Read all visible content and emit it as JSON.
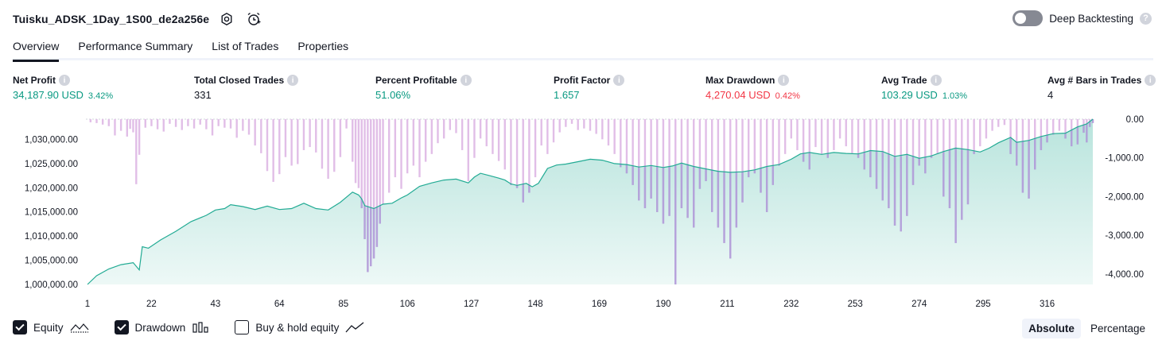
{
  "header": {
    "strategy_title": "Tuisku_ADSK_1Day_1S00_de2a256e",
    "settings_icon": "gear-icon",
    "alert_icon": "alarm-clock-plus-icon",
    "deep_backtesting_label": "Deep Backtesting",
    "deep_backtesting_enabled": false,
    "help_glyph": "?"
  },
  "tabs": [
    {
      "label": "Overview",
      "active": true
    },
    {
      "label": "Performance Summary",
      "active": false
    },
    {
      "label": "List of Trades",
      "active": false
    },
    {
      "label": "Properties",
      "active": false
    }
  ],
  "metrics": [
    {
      "label": "Net Profit",
      "value": "34,187.90 USD",
      "sub": "3.42%",
      "color": "#089981"
    },
    {
      "label": "Total Closed Trades",
      "value": "331",
      "sub": "",
      "color": "#131722"
    },
    {
      "label": "Percent Profitable",
      "value": "51.06%",
      "sub": "",
      "color": "#089981"
    },
    {
      "label": "Profit Factor",
      "value": "1.657",
      "sub": "",
      "color": "#089981"
    },
    {
      "label": "Max Drawdown",
      "value": "4,270.04 USD",
      "sub": "0.42%",
      "color": "#f23645"
    },
    {
      "label": "Avg Trade",
      "value": "103.29 USD",
      "sub": "1.03%",
      "color": "#089981"
    },
    {
      "label": "Avg # Bars in Trades",
      "value": "4",
      "sub": "",
      "color": "#131722"
    }
  ],
  "legend": {
    "equity_label": "Equity",
    "equity_checked": true,
    "drawdown_label": "Drawdown",
    "drawdown_checked": true,
    "buyhold_label": "Buy & hold equity",
    "buyhold_checked": false
  },
  "mode": {
    "absolute_label": "Absolute",
    "percentage_label": "Percentage",
    "active": "Absolute"
  },
  "colors": {
    "equity_line": "#22ab94",
    "drawdown_bar": "#e1bee7",
    "drawdown_bar_overlap": "#b39ddb",
    "negative": "#f23645",
    "positive": "#089981"
  },
  "chart_data": {
    "type": "area",
    "x_ticks": [
      1,
      22,
      43,
      64,
      85,
      106,
      127,
      148,
      169,
      190,
      211,
      232,
      253,
      274,
      295,
      316
    ],
    "x_range": [
      1,
      331
    ],
    "left_axis": {
      "ticks": [
        1000000,
        1005000,
        1010000,
        1015000,
        1020000,
        1025000,
        1030000
      ],
      "tick_labels": [
        "1,000,000.00",
        "1,005,000.00",
        "1,010,000.00",
        "1,015,000.00",
        "1,020,000.00",
        "1,025,000.00",
        "1,030,000.00"
      ],
      "range": [
        1000000,
        1034187.9
      ]
    },
    "right_axis": {
      "ticks": [
        0,
        -1000,
        -2000,
        -3000,
        -4000
      ],
      "tick_labels": [
        "0.00",
        "-1,000.00",
        "-2,000.00",
        "-3,000.00",
        "-4,000.00"
      ],
      "range": [
        -4270.04,
        0
      ]
    },
    "series": [
      {
        "name": "Equity",
        "type": "area",
        "points": [
          [
            1,
            1000000
          ],
          [
            4,
            1001800
          ],
          [
            8,
            1003200
          ],
          [
            12,
            1004100
          ],
          [
            16,
            1004500
          ],
          [
            18,
            1003000
          ],
          [
            19,
            1007800
          ],
          [
            21,
            1007500
          ],
          [
            25,
            1009200
          ],
          [
            30,
            1011000
          ],
          [
            35,
            1013000
          ],
          [
            40,
            1014300
          ],
          [
            43,
            1015400
          ],
          [
            46,
            1015700
          ],
          [
            48,
            1016500
          ],
          [
            52,
            1016100
          ],
          [
            56,
            1015500
          ],
          [
            60,
            1016200
          ],
          [
            64,
            1015500
          ],
          [
            68,
            1015700
          ],
          [
            72,
            1016800
          ],
          [
            76,
            1015700
          ],
          [
            80,
            1015400
          ],
          [
            84,
            1017000
          ],
          [
            88,
            1019100
          ],
          [
            90,
            1018500
          ],
          [
            91,
            1017700
          ],
          [
            92,
            1016300
          ],
          [
            95,
            1015700
          ],
          [
            98,
            1016600
          ],
          [
            101,
            1016800
          ],
          [
            104,
            1017900
          ],
          [
            106,
            1018500
          ],
          [
            110,
            1020300
          ],
          [
            114,
            1021000
          ],
          [
            118,
            1021600
          ],
          [
            122,
            1021800
          ],
          [
            126,
            1021000
          ],
          [
            128,
            1022200
          ],
          [
            130,
            1023000
          ],
          [
            133,
            1022500
          ],
          [
            136,
            1022000
          ],
          [
            138,
            1021600
          ],
          [
            140,
            1020800
          ],
          [
            142,
            1020500
          ],
          [
            145,
            1020900
          ],
          [
            147,
            1020200
          ],
          [
            149,
            1020900
          ],
          [
            152,
            1024000
          ],
          [
            155,
            1024700
          ],
          [
            158,
            1024900
          ],
          [
            162,
            1025400
          ],
          [
            166,
            1025900
          ],
          [
            170,
            1025700
          ],
          [
            174,
            1025000
          ],
          [
            178,
            1024800
          ],
          [
            182,
            1024300
          ],
          [
            186,
            1024600
          ],
          [
            190,
            1024200
          ],
          [
            193,
            1024500
          ],
          [
            196,
            1025100
          ],
          [
            200,
            1024400
          ],
          [
            204,
            1023900
          ],
          [
            208,
            1023400
          ],
          [
            212,
            1023200
          ],
          [
            216,
            1023300
          ],
          [
            220,
            1023700
          ],
          [
            224,
            1024400
          ],
          [
            228,
            1024800
          ],
          [
            232,
            1025900
          ],
          [
            235,
            1027000
          ],
          [
            238,
            1027300
          ],
          [
            242,
            1026900
          ],
          [
            246,
            1027300
          ],
          [
            250,
            1027100
          ],
          [
            254,
            1027000
          ],
          [
            258,
            1027700
          ],
          [
            262,
            1027500
          ],
          [
            266,
            1026500
          ],
          [
            270,
            1026900
          ],
          [
            274,
            1026100
          ],
          [
            278,
            1026600
          ],
          [
            282,
            1027500
          ],
          [
            286,
            1028200
          ],
          [
            290,
            1027900
          ],
          [
            294,
            1027400
          ],
          [
            297,
            1028200
          ],
          [
            300,
            1029300
          ],
          [
            304,
            1030400
          ],
          [
            306,
            1029400
          ],
          [
            310,
            1029800
          ],
          [
            314,
            1030600
          ],
          [
            318,
            1031200
          ],
          [
            322,
            1031300
          ],
          [
            326,
            1032600
          ],
          [
            329,
            1033200
          ],
          [
            331,
            1034187.9
          ]
        ]
      },
      {
        "name": "Drawdown",
        "type": "bar",
        "points": [
          [
            2,
            -80
          ],
          [
            4,
            -100
          ],
          [
            6,
            -140
          ],
          [
            8,
            -180
          ],
          [
            10,
            -420
          ],
          [
            12,
            -300
          ],
          [
            14,
            -450
          ],
          [
            15,
            -250
          ],
          [
            16,
            -340
          ],
          [
            17,
            -1680
          ],
          [
            18,
            -920
          ],
          [
            20,
            -220
          ],
          [
            22,
            -180
          ],
          [
            24,
            -260
          ],
          [
            26,
            -320
          ],
          [
            28,
            -120
          ],
          [
            30,
            -200
          ],
          [
            32,
            -280
          ],
          [
            34,
            -180
          ],
          [
            36,
            -240
          ],
          [
            38,
            -140
          ],
          [
            40,
            -260
          ],
          [
            42,
            -420
          ],
          [
            44,
            -180
          ],
          [
            46,
            -220
          ],
          [
            48,
            -240
          ],
          [
            50,
            -480
          ],
          [
            52,
            -300
          ],
          [
            54,
            -400
          ],
          [
            56,
            -680
          ],
          [
            58,
            -880
          ],
          [
            60,
            -1340
          ],
          [
            62,
            -1620
          ],
          [
            64,
            -1420
          ],
          [
            66,
            -980
          ],
          [
            68,
            -1200
          ],
          [
            70,
            -1160
          ],
          [
            72,
            -800
          ],
          [
            74,
            -720
          ],
          [
            76,
            -860
          ],
          [
            78,
            -1280
          ],
          [
            80,
            -1540
          ],
          [
            82,
            -1360
          ],
          [
            84,
            -980
          ],
          [
            86,
            -240
          ],
          [
            88,
            -1100
          ],
          [
            89,
            -1650
          ],
          [
            90,
            -1780
          ],
          [
            91,
            -2300
          ],
          [
            92,
            -3100
          ],
          [
            93,
            -3950
          ],
          [
            94,
            -3800
          ],
          [
            95,
            -3600
          ],
          [
            96,
            -3300
          ],
          [
            97,
            -2700
          ],
          [
            98,
            -2200
          ],
          [
            100,
            -1900
          ],
          [
            102,
            -1500
          ],
          [
            104,
            -1800
          ],
          [
            106,
            -1400
          ],
          [
            108,
            -1200
          ],
          [
            110,
            -1500
          ],
          [
            112,
            -1100
          ],
          [
            114,
            -900
          ],
          [
            116,
            -620
          ],
          [
            118,
            -500
          ],
          [
            120,
            -280
          ],
          [
            122,
            -360
          ],
          [
            124,
            -800
          ],
          [
            126,
            -1600
          ],
          [
            128,
            -1000
          ],
          [
            130,
            -500
          ],
          [
            132,
            -700
          ],
          [
            134,
            -900
          ],
          [
            136,
            -1080
          ],
          [
            138,
            -1300
          ],
          [
            140,
            -1700
          ],
          [
            142,
            -1780
          ],
          [
            144,
            -2150
          ],
          [
            146,
            -1900
          ],
          [
            148,
            -1500
          ],
          [
            150,
            -680
          ],
          [
            152,
            -900
          ],
          [
            154,
            -600
          ],
          [
            156,
            -340
          ],
          [
            158,
            -200
          ],
          [
            160,
            -120
          ],
          [
            162,
            -280
          ],
          [
            164,
            -240
          ],
          [
            166,
            -300
          ],
          [
            168,
            -380
          ],
          [
            170,
            -520
          ],
          [
            172,
            -680
          ],
          [
            174,
            -900
          ],
          [
            176,
            -1240
          ],
          [
            178,
            -1400
          ],
          [
            180,
            -1700
          ],
          [
            182,
            -2100
          ],
          [
            184,
            -2300
          ],
          [
            186,
            -2050
          ],
          [
            188,
            -2400
          ],
          [
            190,
            -2700
          ],
          [
            192,
            -2500
          ],
          [
            194,
            -4270
          ],
          [
            196,
            -2300
          ],
          [
            198,
            -2550
          ],
          [
            200,
            -2800
          ],
          [
            202,
            -1800
          ],
          [
            204,
            -1600
          ],
          [
            206,
            -2400
          ],
          [
            208,
            -2800
          ],
          [
            210,
            -3200
          ],
          [
            212,
            -3600
          ],
          [
            214,
            -2800
          ],
          [
            216,
            -2150
          ],
          [
            218,
            -1500
          ],
          [
            220,
            -1400
          ],
          [
            222,
            -1900
          ],
          [
            224,
            -2400
          ],
          [
            226,
            -1700
          ],
          [
            228,
            -1200
          ],
          [
            230,
            -900
          ],
          [
            232,
            -500
          ],
          [
            234,
            -800
          ],
          [
            236,
            -1100
          ],
          [
            238,
            -1300
          ],
          [
            240,
            -720
          ],
          [
            242,
            -900
          ],
          [
            244,
            -1000
          ],
          [
            246,
            -800
          ],
          [
            248,
            -500
          ],
          [
            250,
            -700
          ],
          [
            252,
            -880
          ],
          [
            254,
            -1000
          ],
          [
            256,
            -1300
          ],
          [
            258,
            -1500
          ],
          [
            260,
            -1800
          ],
          [
            262,
            -2100
          ],
          [
            264,
            -2300
          ],
          [
            266,
            -2750
          ],
          [
            268,
            -2900
          ],
          [
            270,
            -2500
          ],
          [
            272,
            -1700
          ],
          [
            274,
            -1200
          ],
          [
            276,
            -1400
          ],
          [
            278,
            -1000
          ],
          [
            280,
            -900
          ],
          [
            282,
            -2000
          ],
          [
            284,
            -2300
          ],
          [
            286,
            -3200
          ],
          [
            288,
            -2600
          ],
          [
            290,
            -2200
          ],
          [
            292,
            -900
          ],
          [
            294,
            -700
          ],
          [
            296,
            -500
          ],
          [
            298,
            -300
          ],
          [
            300,
            -200
          ],
          [
            302,
            -150
          ],
          [
            304,
            -900
          ],
          [
            306,
            -1200
          ],
          [
            308,
            -1900
          ],
          [
            310,
            -2050
          ],
          [
            312,
            -1300
          ],
          [
            314,
            -800
          ],
          [
            316,
            -600
          ],
          [
            318,
            -400
          ],
          [
            320,
            -300
          ],
          [
            322,
            -500
          ],
          [
            324,
            -700
          ],
          [
            326,
            -650
          ],
          [
            328,
            -350
          ],
          [
            329,
            -600
          ],
          [
            330,
            -200
          ],
          [
            331,
            -100
          ]
        ]
      }
    ]
  }
}
